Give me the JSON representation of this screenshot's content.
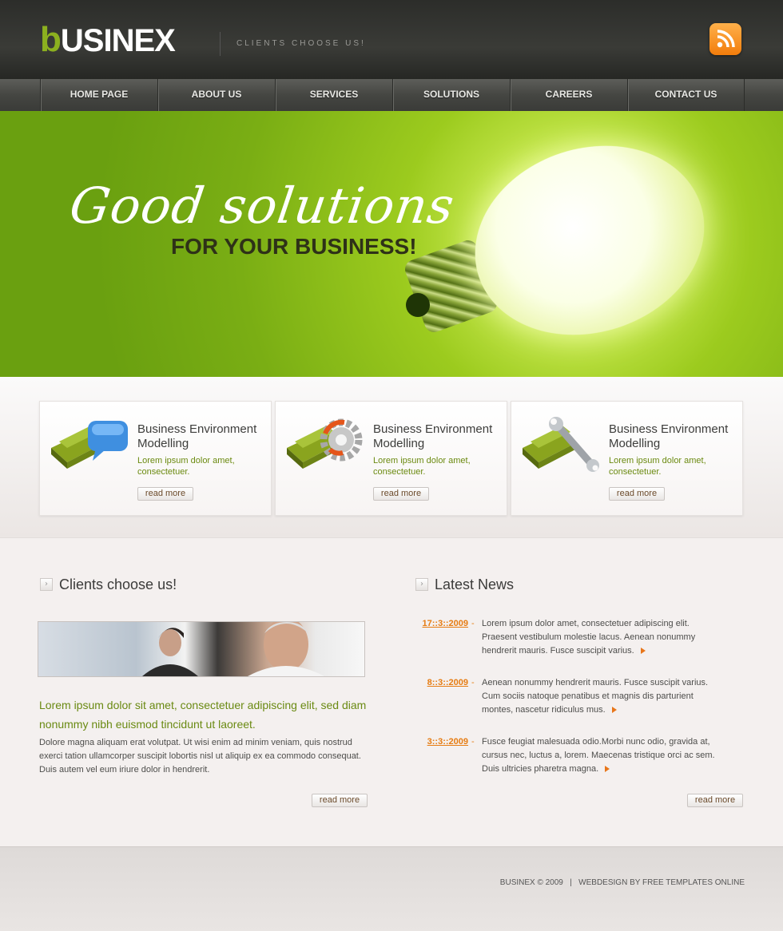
{
  "header": {
    "logo_b": "b",
    "logo_rest": "USINEX",
    "tagline": "CLIENTS CHOOSE US!",
    "rss_icon": "rss-icon"
  },
  "nav": {
    "items": [
      "HOME PAGE",
      "ABOUT US",
      "SERVICES",
      "SOLUTIONS",
      "CAREERS",
      "CONTACT US"
    ]
  },
  "banner": {
    "script_text": "Good solutions",
    "subtitle": "FOR YOUR BUSINESS!"
  },
  "features": [
    {
      "title": "Business Environment Modelling",
      "text": "Lorem ipsum dolor amet, consectetuer.",
      "button": "read more",
      "icon": "speech-bubble-icon"
    },
    {
      "title": "Business Environment Modelling",
      "text": "Lorem ipsum dolor amet, consectetuer.",
      "button": "read more",
      "icon": "gear-icon"
    },
    {
      "title": "Business Environment Modelling",
      "text": "Lorem ipsum dolor amet, consectetuer.",
      "button": "read more",
      "icon": "wrench-icon"
    }
  ],
  "clients": {
    "title": "Clients choose us!",
    "lead": "Lorem ipsum dolor sit amet, consectetuer adipiscing elit, sed diam nonummy nibh euismod tincidunt ut laoreet.",
    "body": "Dolore magna aliquam erat volutpat. Ut wisi enim ad minim veniam, quis nostrud exerci tation ullamcorper suscipit lobortis nisl ut aliquip ex ea commodo consequat. Duis autem vel eum iriure dolor in hendrerit.",
    "button": "read more"
  },
  "news": {
    "title": "Latest News",
    "items": [
      {
        "date": "17::3::2009",
        "text": "Lorem ipsum dolor amet, consectetuer adipiscing elit. Praesent vestibulum molestie lacus. Aenean nonummy hendrerit mauris. Fusce suscipit varius."
      },
      {
        "date": "8::3::2009",
        "text": "Aenean nonummy hendrerit mauris. Fusce suscipit varius. Cum sociis natoque penatibus et magnis dis parturient montes, nascetur ridiculus mus."
      },
      {
        "date": "3::3::2009",
        "text": "Fusce feugiat malesuada odio.Morbi nunc odio, gravida at, cursus nec, luctus a, lorem. Maecenas tristique orci ac sem. Duis ultricies pharetra magna."
      }
    ],
    "dash": "-",
    "button": "read more"
  },
  "footer": {
    "copyright": "BUSINEX © 2009",
    "separator": "|",
    "credit": "WEBDESIGN BY FREE TEMPLATES ONLINE"
  },
  "colors": {
    "accent_green": "#8cb01f",
    "accent_orange": "#e67c12"
  }
}
